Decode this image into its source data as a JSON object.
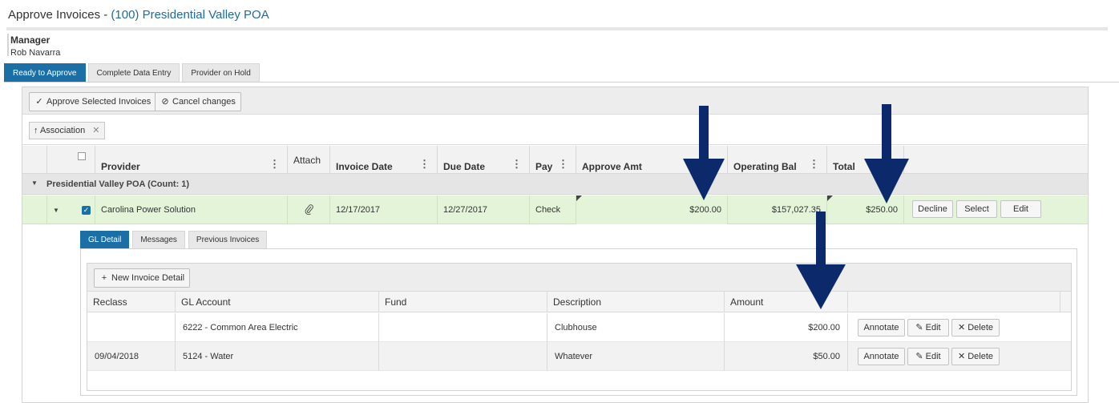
{
  "page": {
    "title_prefix": "Approve Invoices - ",
    "title_association": "(100) Presidential Valley POA"
  },
  "manager": {
    "role": "Manager",
    "name": "Rob Navarra"
  },
  "tabs": [
    {
      "label": "Ready to Approve",
      "active": true
    },
    {
      "label": "Complete Data Entry",
      "active": false
    },
    {
      "label": "Provider on Hold",
      "active": false
    }
  ],
  "toolbar": {
    "approve_label": "Approve Selected Invoices",
    "cancel_label": "Cancel changes"
  },
  "grouping": {
    "chip_label": "Association"
  },
  "grid": {
    "columns": [
      "Provider",
      "Attach",
      "Invoice Date",
      "Due Date",
      "Pay",
      "Approve Amt",
      "Operating Bal",
      "Total"
    ],
    "group_label": "Presidential Valley POA (Count: 1)",
    "row": {
      "checked": true,
      "provider": "Carolina Power Solution",
      "invoice_date": "12/17/2017",
      "due_date": "12/27/2017",
      "pay": "Check",
      "approve_amt": "$200.00",
      "operating_bal": "$157,027.35",
      "total": "$250.00",
      "actions": [
        "Decline",
        "Select",
        "Edit"
      ]
    }
  },
  "detail": {
    "tabs": [
      {
        "label": "GL Detail",
        "active": true
      },
      {
        "label": "Messages",
        "active": false
      },
      {
        "label": "Previous Invoices",
        "active": false
      }
    ],
    "new_button": "New Invoice Detail",
    "columns": [
      "Reclass",
      "GL Account",
      "Fund",
      "Description",
      "Amount"
    ],
    "rows": [
      {
        "reclass": "",
        "gl_account": "6222 - Common Area Electric",
        "fund": "",
        "description": "Clubhouse",
        "amount": "$200.00"
      },
      {
        "reclass": "09/04/2018",
        "gl_account": "5124 - Water",
        "fund": "",
        "description": "Whatever",
        "amount": "$50.00"
      }
    ],
    "actions": {
      "annotate": "Annotate",
      "edit": "Edit",
      "delete": "Delete"
    }
  },
  "colors": {
    "accent": "#1a6fa6",
    "selected_row": "#e3f4d9",
    "arrow": "#0c2a6b"
  },
  "icons": {
    "approve": "check-icon",
    "cancel": "cancel-circle-icon",
    "group_sort": "arrow-up-icon",
    "attach": "paperclip-icon",
    "new": "plus-icon",
    "edit": "pencil-icon",
    "delete": "x-icon"
  }
}
